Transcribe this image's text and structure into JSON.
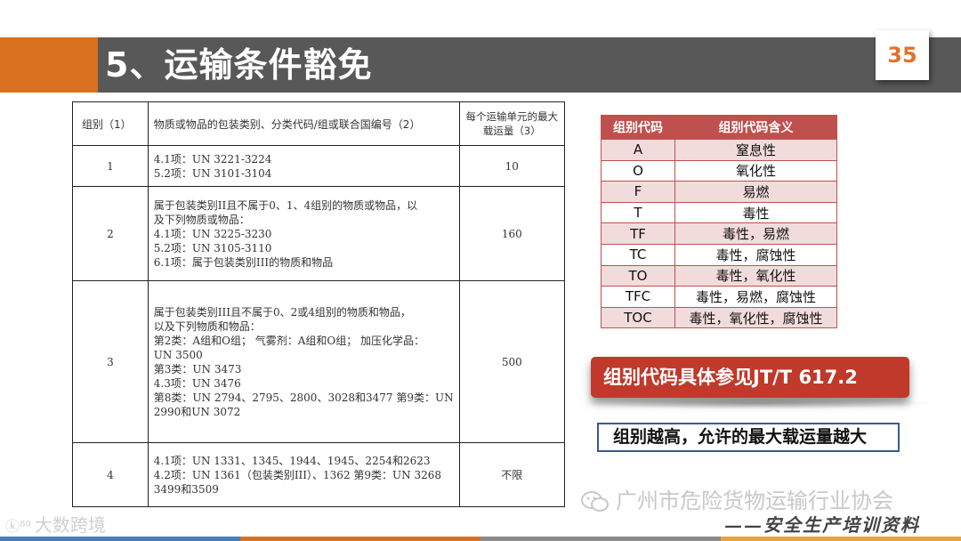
{
  "header": {
    "title": "5、运输条件豁免",
    "page_number": "35"
  },
  "main_table": {
    "headers": [
      "组别（1）",
      "物质或物品的包装类别、分类代码/组或联合国编号（2）",
      "每个运输单元的最大载运量（3）"
    ],
    "rows": [
      {
        "group": "1",
        "lines": [
          "4.1项：UN 3221-3224",
          "5.2项：UN 3101-3104"
        ],
        "max": "10"
      },
      {
        "group": "2",
        "lines": [
          "属于包装类别II且不属于0、1、4组别的物质或物品，以",
          "及下列物质或物品：",
          "4.1项：UN 3225-3230",
          "5.2项：UN 3105-3110",
          "6.1项：属于包装类别III的物质和物品"
        ],
        "max": "160"
      },
      {
        "group": "3",
        "lines": [
          "属于包装类别III且不属于0、2或4组别的物质和物品，",
          "以及下列物质和物品：",
          "第2类：A组和O组；  气雾剂：A组和O组；  加压化学品：",
          "UN 3500",
          "第3类：UN 3473",
          "4.3项：UN 3476",
          "第8类：UN 2794、2795、2800、3028和3477  第9类：UN",
          "2990和UN 3072"
        ],
        "max": "500"
      },
      {
        "group": "4",
        "lines": [
          "4.1项：UN 1331、1345、1944、1945、2254和2623",
          "4.2项：UN 1361（包装类别III）、1362  第9类：UN 3268",
          "3499和3509"
        ],
        "max": "不限"
      }
    ]
  },
  "code_table": {
    "headers": [
      "组别代码",
      "组别代码含义"
    ],
    "rows": [
      [
        "A",
        "窒息性"
      ],
      [
        "O",
        "氧化性"
      ],
      [
        "F",
        "易燃"
      ],
      [
        "T",
        "毒性"
      ],
      [
        "TF",
        "毒性，易燃"
      ],
      [
        "TC",
        "毒性，腐蚀性"
      ],
      [
        "TO",
        "毒性，氧化性"
      ],
      [
        "TFC",
        "毒性，易燃，腐蚀性"
      ],
      [
        "TOC",
        "毒性，氧化性，腐蚀性"
      ]
    ]
  },
  "callouts": {
    "reference": "组别代码具体参见JT/T 617.2",
    "note": "组别越高，允许的最大载运量越大"
  },
  "watermarks": {
    "association": "广州市危险货物运输行业协会",
    "slogan": "——安全生产培训资料",
    "logo": "大数跨境"
  },
  "colors": {
    "accent": "#d9711f",
    "title_band": "#585858",
    "code_header": "#c0504d",
    "callout_red": "#c0392b",
    "note_border": "#3a5a8f"
  }
}
